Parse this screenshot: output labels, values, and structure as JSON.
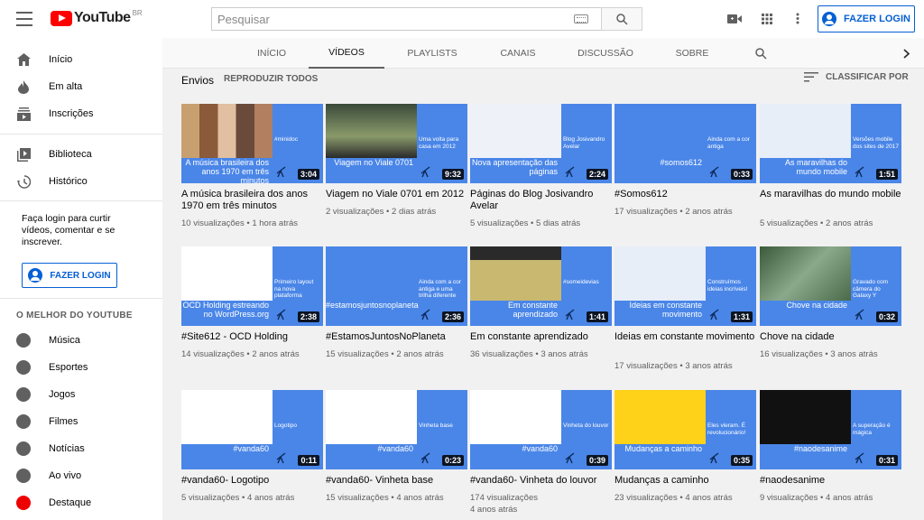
{
  "header": {
    "logo_text": "YouTube",
    "logo_country": "BR",
    "search_placeholder": "Pesquisar",
    "login_label": "FAZER LOGIN",
    "icons": [
      "menu-icon",
      "keyboard-icon",
      "search-icon",
      "video-camera-icon",
      "apps-grid-icon",
      "more-vert-icon",
      "account-icon"
    ]
  },
  "sidebar": {
    "items_top": [
      {
        "label": "Início",
        "icon": "home-icon"
      },
      {
        "label": "Em alta",
        "icon": "flame-icon"
      },
      {
        "label": "Inscrições",
        "icon": "subscriptions-icon"
      }
    ],
    "items_library": [
      {
        "label": "Biblioteca",
        "icon": "library-icon"
      },
      {
        "label": "Histórico",
        "icon": "history-icon"
      }
    ],
    "login_prompt": "Faça login para curtir vídeos, comentar e se inscrever.",
    "login_label": "FAZER LOGIN",
    "best_of_title": "O MELHOR DO YOUTUBE",
    "best_of": [
      {
        "label": "Música",
        "icon": "music-icon"
      },
      {
        "label": "Esportes",
        "icon": "sports-icon"
      },
      {
        "label": "Jogos",
        "icon": "gaming-icon"
      },
      {
        "label": "Filmes",
        "icon": "movies-icon"
      },
      {
        "label": "Notícias",
        "icon": "news-icon"
      },
      {
        "label": "Ao vivo",
        "icon": "live-icon"
      },
      {
        "label": "Destaque",
        "icon": "spotlight-icon"
      }
    ]
  },
  "tabs": [
    "INÍCIO",
    "VÍDEOS",
    "PLAYLISTS",
    "CANAIS",
    "DISCUSSÃO",
    "SOBRE"
  ],
  "active_tab": "VÍDEOS",
  "section": {
    "title": "Envios",
    "play_all": "REPRODUZIR TODOS",
    "sort_label": "CLASSIFICAR POR"
  },
  "videos": [
    {
      "title": "A música brasileira dos anos 1970 em três minutos",
      "views": "10 visualizações",
      "age": "1 hora atrás",
      "duration": "3:04",
      "caption": "A música brasileira dos anos 1970 em três minutos",
      "side": "#minidoc",
      "art": "art-bars"
    },
    {
      "title": "Viagem no Viale 0701 em 2012",
      "views": "2 visualizações",
      "age": "2 dias atrás",
      "duration": "9:32",
      "caption": "Viagem no Viale 0701",
      "side": "Uma volta para casa em 2012",
      "art": "art-bus"
    },
    {
      "title": "Páginas do Blog Josivandro Avelar",
      "views": "5 visualizações",
      "age": "5 dias atrás",
      "duration": "2:24",
      "caption": "Nova apresentação das páginas",
      "side": "Blog Josivandro Avelar",
      "art": "art-blog"
    },
    {
      "title": "#Somos612",
      "views": "17 visualizações",
      "age": "2 anos atrás",
      "duration": "0:33",
      "caption": "#somos612",
      "side": "Ainda com a cor antiga",
      "art": "art-612"
    },
    {
      "title": "As maravilhas do mundo mobile",
      "views": "5 visualizações",
      "age": "2 anos atrás",
      "duration": "1:51",
      "caption": "As maravilhas do mundo mobile",
      "side": "Versões mobile dos sites de 2017",
      "art": "art-site"
    },
    {
      "title": "#Site612 - OCD Holding",
      "views": "14 visualizações",
      "age": "2 anos atrás",
      "duration": "2:38",
      "caption": "OCD Holding estreando no WordPress.org",
      "side": "Primeiro layout na nova plataforma",
      "art": "art-ocd"
    },
    {
      "title": "#EstamosJuntosNoPlaneta",
      "views": "15 visualizações",
      "age": "2 anos atrás",
      "duration": "2:36",
      "caption": "#estamosjuntosnoplaneta",
      "side": "Ainda com a cor antiga e uma trilha diferente",
      "art": "art-612"
    },
    {
      "title": "Em constante aprendizado",
      "views": "36 visualizações",
      "age": "3 anos atrás",
      "duration": "1:41",
      "caption": "Em constante aprendizado",
      "side": "#someidevias",
      "art": "art-nao"
    },
    {
      "title": "Ideias em constante movimento",
      "views": "17 visualizações",
      "age": "3 anos atrás",
      "duration": "1:31",
      "caption": "Ideias em constante movimento",
      "side": "Construímos ideias incríveis!",
      "art": "art-site"
    },
    {
      "title": "Chove na cidade",
      "views": "16 visualizações",
      "age": "3 anos atrás",
      "duration": "0:32",
      "caption": "Chove na cidade",
      "side": "Gravado com câmera do Galaxy Y",
      "art": "art-tree"
    },
    {
      "title": "#vanda60- Logotipo",
      "views": "5 visualizações",
      "age": "4 anos atrás",
      "duration": "0:11",
      "caption": "#vanda60",
      "side": "Logotipo",
      "art": "art-vanda"
    },
    {
      "title": "#vanda60- Vinheta base",
      "views": "15 visualizações",
      "age": "4 anos atrás",
      "duration": "0:23",
      "caption": "#vanda60",
      "side": "Vinheta base",
      "art": "art-vanda"
    },
    {
      "title": "#vanda60- Vinheta do louvor",
      "views": "174 visualizações",
      "age": "4 anos atrás",
      "duration": "0:39",
      "caption": "#vanda60",
      "side": "Vinheta do louvor",
      "art": "art-vanda"
    },
    {
      "title": "Mudanças a caminho",
      "views": "23 visualizações",
      "age": "4 anos atrás",
      "duration": "0:35",
      "caption": "Mudanças a caminho",
      "side": "Eles vieram. É revolucionário!",
      "art": "art-balloon"
    },
    {
      "title": "#naodesanime",
      "views": "9 visualizações",
      "age": "4 anos atrás",
      "duration": "0:31",
      "caption": "#naodesanime",
      "side": "A superação é mágica",
      "art": "art-green"
    }
  ],
  "colors": {
    "accent": "#065fd4",
    "thumb_blue": "#4a86e8",
    "logo_red": "#ff0000"
  }
}
